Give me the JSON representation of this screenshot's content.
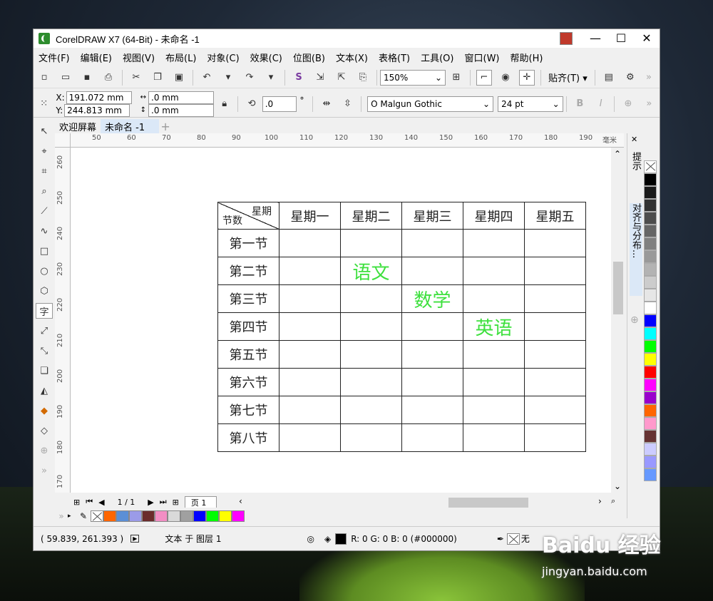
{
  "window": {
    "title": "CorelDRAW X7 (64-Bit) - 未命名 -1",
    "controls": [
      "—",
      "☐",
      "✕"
    ]
  },
  "menu": [
    "文件(F)",
    "编辑(E)",
    "视图(V)",
    "布局(L)",
    "对象(C)",
    "效果(C)",
    "位图(B)",
    "文本(X)",
    "表格(T)",
    "工具(O)",
    "窗口(W)",
    "帮助(H)"
  ],
  "toolbar": {
    "zoom": "150%",
    "snap_label": "贴齐(T)"
  },
  "property_bar": {
    "x_label": "X:",
    "x_value": "191.072 mm",
    "y_label": "Y:",
    "y_value": "244.813 mm",
    "width_value": ".0 mm",
    "height_value": ".0 mm",
    "rotation_value": ".0",
    "degree_symbol": "°",
    "font": "Malgun Gothic",
    "font_size": "24 pt"
  },
  "tabs": [
    "欢迎屏幕",
    "未命名 -1"
  ],
  "ruler": {
    "unit": "毫米",
    "h_ticks": [
      "50",
      "60",
      "70",
      "80",
      "90",
      "100",
      "110",
      "120",
      "130",
      "140",
      "150",
      "160",
      "170",
      "180",
      "190"
    ],
    "v_ticks": [
      "260",
      "250",
      "240",
      "230",
      "220",
      "210",
      "200",
      "190",
      "180",
      "170"
    ]
  },
  "table": {
    "corner_top": "星期",
    "corner_bottom": "节数",
    "days": [
      "星期一",
      "星期二",
      "星期三",
      "星期四",
      "星期五"
    ],
    "periods": [
      "第一节",
      "第二节",
      "第三节",
      "第四节",
      "第五节",
      "第六节",
      "第七节",
      "第八节"
    ],
    "subjects": [
      {
        "period": 1,
        "day": 1,
        "text": "语文"
      },
      {
        "period": 2,
        "day": 2,
        "text": "数学"
      },
      {
        "period": 3,
        "day": 3,
        "text": "英语"
      }
    ],
    "subject_color": "#3ee03e"
  },
  "pager": {
    "page_count": "1 / 1",
    "page_tab": "页 1"
  },
  "dock": {
    "hints_tab": "提示",
    "align_tab": "对齐与分布..."
  },
  "document_palette": [
    "#ff6600",
    "#5b8fd6",
    "#9b9be8",
    "#6b2c2c",
    "#f28ec4",
    "#d9d9d9",
    "#a0a0a0",
    "#0000ff",
    "#00ff00",
    "#ffff00",
    "#ff00ff"
  ],
  "color_palette": [
    "#000000",
    "#1a1a1a",
    "#333333",
    "#4d4d4d",
    "#666666",
    "#808080",
    "#999999",
    "#b3b3b3",
    "#cccccc",
    "#e6e6e6",
    "#ffffff",
    "#0000ff",
    "#00ffff",
    "#00ff00",
    "#ffff00",
    "#ff0000",
    "#ff00ff",
    "#9900cc",
    "#ff6600",
    "#ff99cc",
    "#663333",
    "#ccccff",
    "#9999ff",
    "#6699ff"
  ],
  "status": {
    "coords": "( 59.839, 261.393 )",
    "object_info": "文本 于 图层 1",
    "fill_info": "R: 0 G: 0 B: 0 (#000000)",
    "outline_info": "无"
  },
  "watermark": {
    "logo": "Baidu 经验",
    "url": "jingyan.baidu.com"
  }
}
